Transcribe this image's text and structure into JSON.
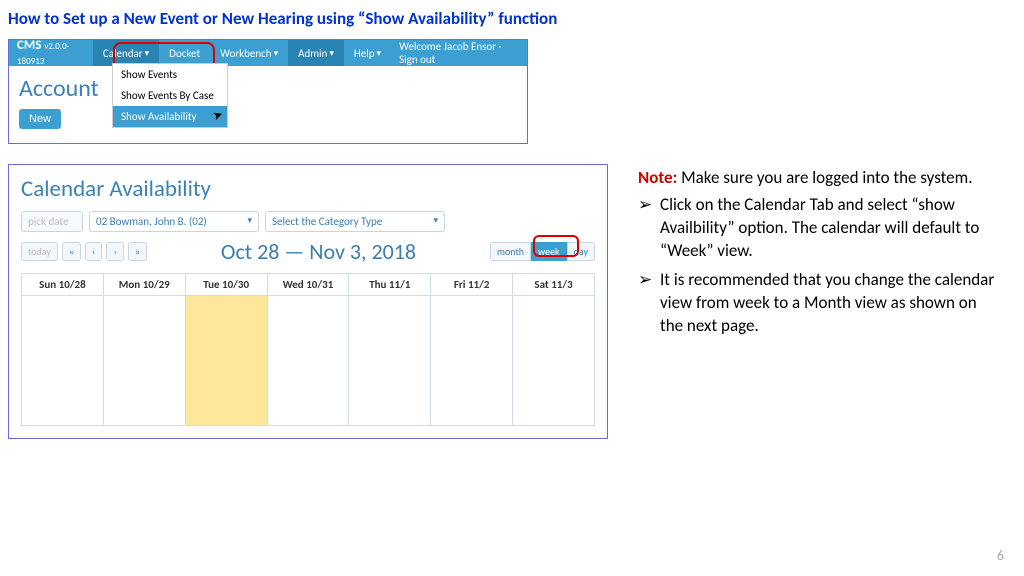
{
  "title": "How to Set up a New Event or New Hearing using “Show Availability” function",
  "topbar": {
    "brand": "CMS",
    "version": "v2.0.0-180913",
    "items": [
      "Calendar",
      "Docket",
      "Workbench",
      "Admin",
      "Help"
    ],
    "welcome": "Welcome Jacob Ensor · Sign out"
  },
  "dropdown": {
    "items": [
      "Show Events",
      "Show Events By Case",
      "Show Availability"
    ],
    "selected_index": 2
  },
  "ss1": {
    "heading": "Account",
    "new_button": "New"
  },
  "ss2": {
    "heading": "Calendar Availability",
    "pick_date": "pick date",
    "judge": "02 Bowman, John B. (02)",
    "category": "Select the Category Type",
    "today": "today",
    "range": "Oct 28 — Nov 3, 2018",
    "views": {
      "month": "month",
      "week": "week",
      "day": "day"
    },
    "days": [
      "Sun 10/28",
      "Mon 10/29",
      "Tue 10/30",
      "Wed 10/31",
      "Thu 11/1",
      "Fri 11/2",
      "Sat 11/3"
    ],
    "highlight_index": 2
  },
  "right": {
    "note_label": "Note:",
    "note_text": " Make sure you are logged into the system.",
    "bullets": [
      "Click on the Calendar Tab and select “show Availbility” option. The calendar will default to “Week” view.",
      "It is recommended that you change the calendar view from week to a Month view as shown on the next page."
    ]
  },
  "page_number": "6"
}
